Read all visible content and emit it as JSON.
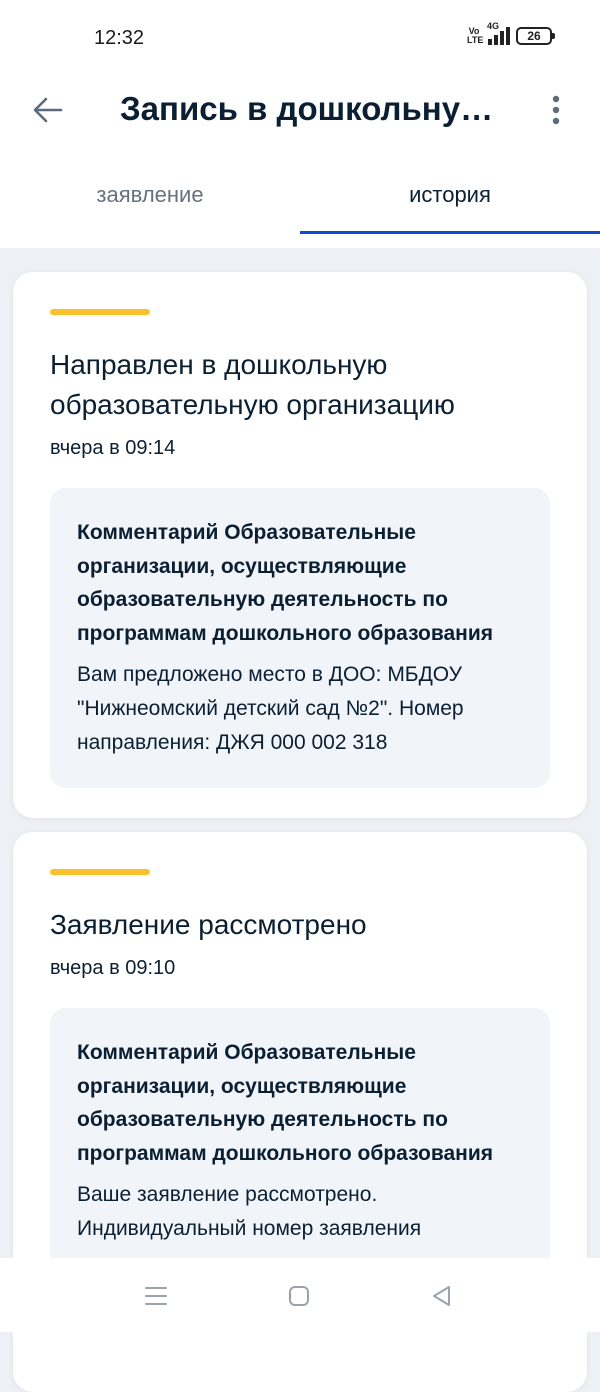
{
  "status_bar": {
    "time": "12:32",
    "volte_label_top": "Vo",
    "volte_label_bottom": "LTE",
    "network": "4G",
    "battery": "26"
  },
  "app_bar": {
    "title": "Запись в дошкольную...",
    "back_icon": "arrow-left-icon",
    "more_icon": "more-vertical-icon"
  },
  "tabs": [
    {
      "label": "заявление",
      "active": false
    },
    {
      "label": "история",
      "active": true
    }
  ],
  "colors": {
    "accent_yellow": "#fbc02d",
    "tab_underline": "#0d4cd3",
    "background": "#edf0f4",
    "comment_bg": "#f1f4f8"
  },
  "history": [
    {
      "title": "Направлен в дошкольную образовательную организацию",
      "time": "вчера в 09:14",
      "comment_head": "Комментарий Образовательные организации, осуществляющие образовательную деятельность по программам дошкольного образования",
      "comment_body": "Вам предложено место в ДОО: МБДОУ \"Нижнеомский детский сад №2\". Номер направления: ДЖЯ 000 002 318"
    },
    {
      "title": "Заявление рассмотрено",
      "time": "вчера в 09:10",
      "comment_head": "Комментарий Образовательные организации, осуществляющие образовательную деятельность по программам дошкольного образования",
      "comment_body": "Ваше заявление рассмотрено. Индивидуальный номер заявления"
    }
  ],
  "nav_bar": {
    "menu_icon": "menu-icon",
    "home_icon": "home-square-icon",
    "back_icon": "back-triangle-icon"
  }
}
